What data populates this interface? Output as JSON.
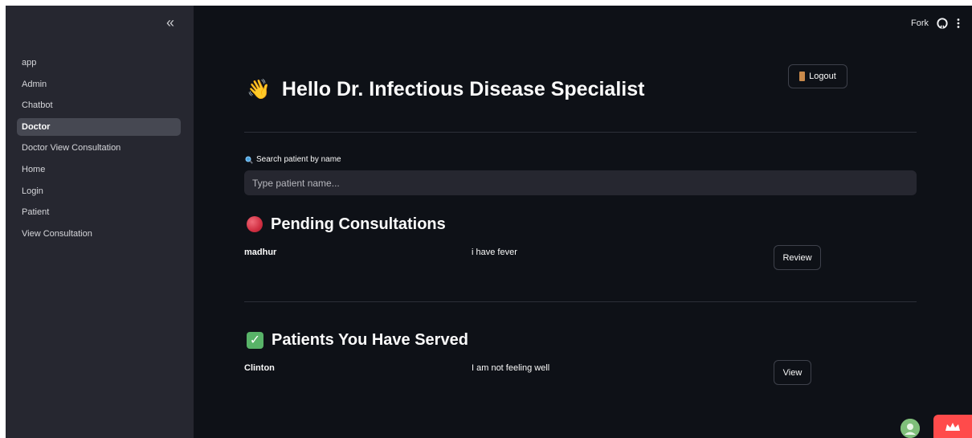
{
  "sidebar": {
    "collapse_icon": "«",
    "items": [
      {
        "label": "app",
        "active": false
      },
      {
        "label": "Admin",
        "active": false
      },
      {
        "label": "Chatbot",
        "active": false
      },
      {
        "label": "Doctor",
        "active": true
      },
      {
        "label": "Doctor View Consultation",
        "active": false
      },
      {
        "label": "Home",
        "active": false
      },
      {
        "label": "Login",
        "active": false
      },
      {
        "label": "Patient",
        "active": false
      },
      {
        "label": "View Consultation",
        "active": false
      }
    ]
  },
  "topbar": {
    "fork_label": "Fork",
    "github_icon": "github-icon",
    "menu_icon": "kebab-menu-icon"
  },
  "main": {
    "greeting_emoji": "👋",
    "greeting": "Hello Dr. Infectious Disease Specialist",
    "logout_label": "Logout",
    "logout_icon": "door-icon",
    "search_label": "Search patient by name",
    "search_icon": "magnifier-icon",
    "search_placeholder": "Type patient name...",
    "search_value": "",
    "pending": {
      "title": "Pending Consultations",
      "icon": "red-circle-icon",
      "rows": [
        {
          "name": "madhur",
          "message": "i have fever",
          "action": "Review"
        }
      ]
    },
    "served": {
      "title": "Patients You Have Served",
      "icon": "check-mark-icon",
      "rows": [
        {
          "name": "Clinton",
          "message": "I am not feeling well",
          "action": "View"
        }
      ]
    }
  },
  "colors": {
    "background": "#0e1117",
    "sidebar": "#262730",
    "accent": "#ff4b4b",
    "check": "#58b368"
  }
}
